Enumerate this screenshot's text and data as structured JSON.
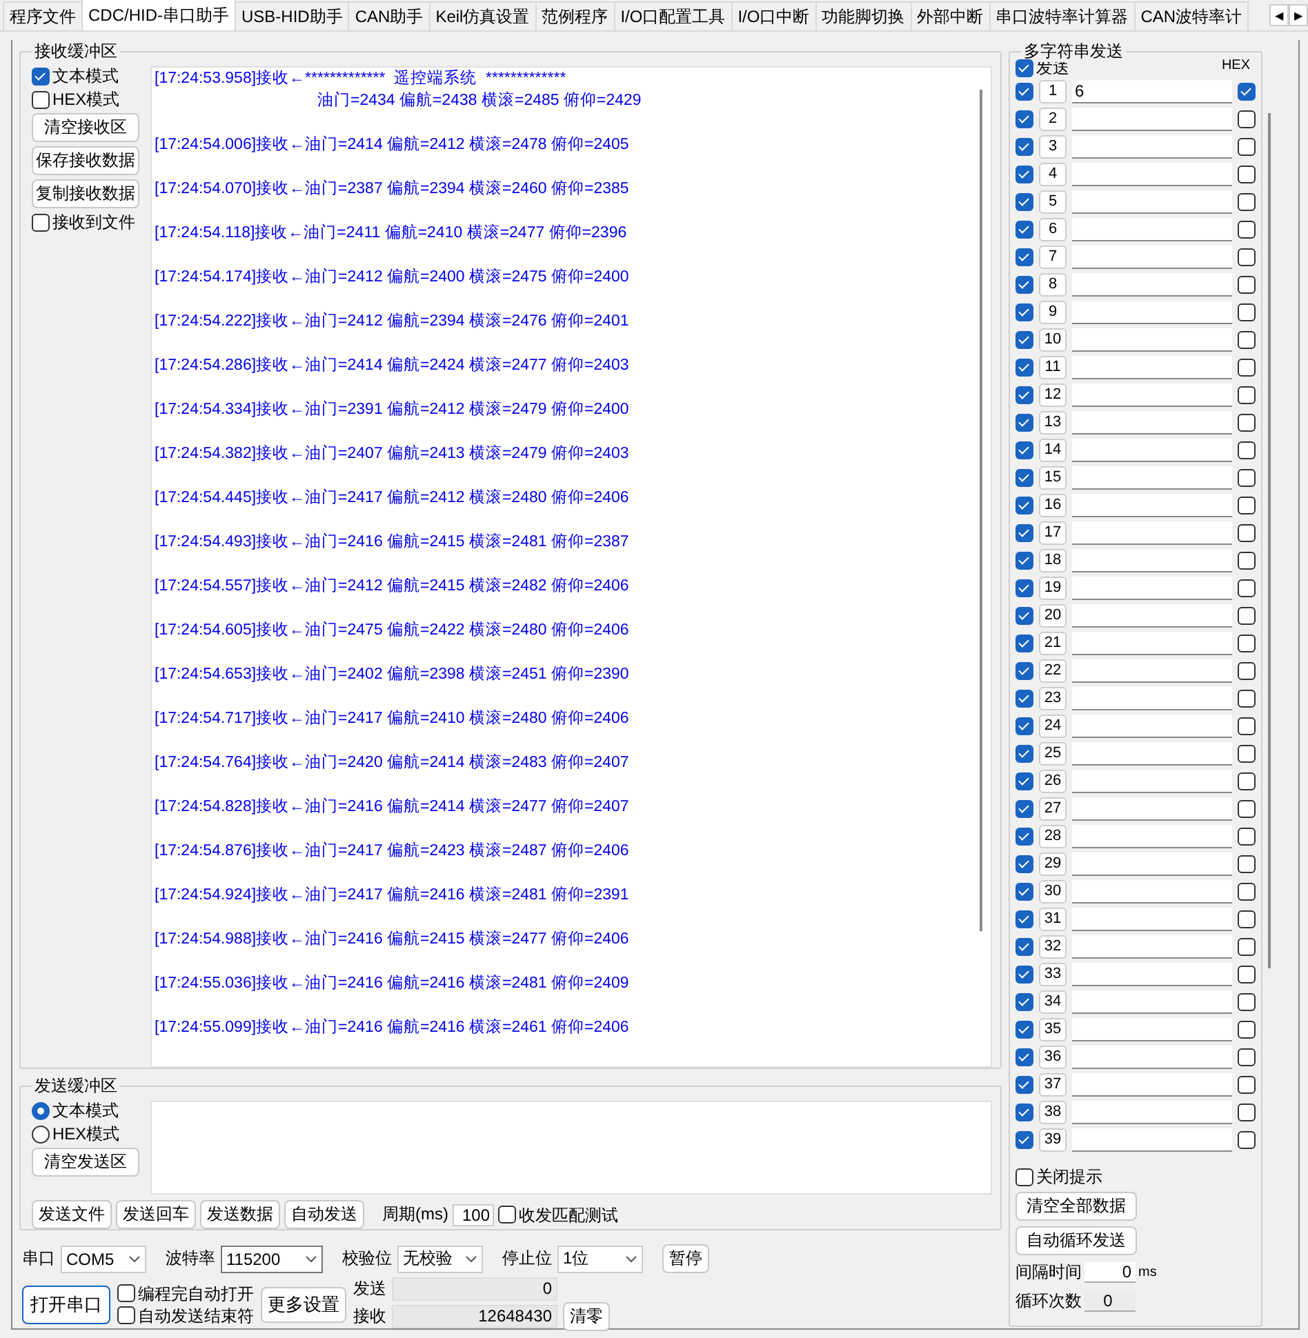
{
  "tabs": [
    {
      "label": "程序文件",
      "selected": false
    },
    {
      "label": "CDC/HID-串口助手",
      "selected": true
    },
    {
      "label": "USB-HID助手",
      "selected": false
    },
    {
      "label": "CAN助手",
      "selected": false
    },
    {
      "label": "Keil仿真设置",
      "selected": false
    },
    {
      "label": "范例程序",
      "selected": false
    },
    {
      "label": "I/O口配置工具",
      "selected": false
    },
    {
      "label": "I/O口中断",
      "selected": false
    },
    {
      "label": "功能脚切换",
      "selected": false
    },
    {
      "label": "外部中断",
      "selected": false
    },
    {
      "label": "串口波特率计算器",
      "selected": false
    },
    {
      "label": "CAN波特率计",
      "selected": false
    }
  ],
  "tab_scroll": [
    "◀",
    "▶"
  ],
  "receive": {
    "title": "接收缓冲区",
    "modes": [
      {
        "label": "文本模式",
        "checked": true
      },
      {
        "label": "HEX模式",
        "checked": false
      }
    ],
    "buttons": [
      "清空接收区",
      "保存接收数据",
      "复制接收数据"
    ],
    "to_file": {
      "label": "接收到文件",
      "checked": false
    },
    "log": [
      {
        "text": "[17:24:53.958]接收←*************  遥控端系统  *************",
        "continuation": "油门=2434 偏航=2438 横滚=2485 俯仰=2429"
      },
      {
        "text": "[17:24:54.006]接收←油门=2414 偏航=2412 横滚=2478 俯仰=2405"
      },
      {
        "text": "[17:24:54.070]接收←油门=2387 偏航=2394 横滚=2460 俯仰=2385"
      },
      {
        "text": "[17:24:54.118]接收←油门=2411 偏航=2410 横滚=2477 俯仰=2396"
      },
      {
        "text": "[17:24:54.174]接收←油门=2412 偏航=2400 横滚=2475 俯仰=2400"
      },
      {
        "text": "[17:24:54.222]接收←油门=2412 偏航=2394 横滚=2476 俯仰=2401"
      },
      {
        "text": "[17:24:54.286]接收←油门=2414 偏航=2424 横滚=2477 俯仰=2403"
      },
      {
        "text": "[17:24:54.334]接收←油门=2391 偏航=2412 横滚=2479 俯仰=2400"
      },
      {
        "text": "[17:24:54.382]接收←油门=2407 偏航=2413 横滚=2479 俯仰=2403"
      },
      {
        "text": "[17:24:54.445]接收←油门=2417 偏航=2412 横滚=2480 俯仰=2406"
      },
      {
        "text": "[17:24:54.493]接收←油门=2416 偏航=2415 横滚=2481 俯仰=2387"
      },
      {
        "text": "[17:24:54.557]接收←油门=2412 偏航=2415 横滚=2482 俯仰=2406"
      },
      {
        "text": "[17:24:54.605]接收←油门=2475 偏航=2422 横滚=2480 俯仰=2406"
      },
      {
        "text": "[17:24:54.653]接收←油门=2402 偏航=2398 横滚=2451 俯仰=2390"
      },
      {
        "text": "[17:24:54.717]接收←油门=2417 偏航=2410 横滚=2480 俯仰=2406"
      },
      {
        "text": "[17:24:54.764]接收←油门=2420 偏航=2414 横滚=2483 俯仰=2407"
      },
      {
        "text": "[17:24:54.828]接收←油门=2416 偏航=2414 横滚=2477 俯仰=2407"
      },
      {
        "text": "[17:24:54.876]接收←油门=2417 偏航=2423 横滚=2487 俯仰=2406"
      },
      {
        "text": "[17:24:54.924]接收←油门=2417 偏航=2416 横滚=2481 俯仰=2391"
      },
      {
        "text": "[17:24:54.988]接收←油门=2416 偏航=2415 横滚=2477 俯仰=2406"
      },
      {
        "text": "[17:24:55.036]接收←油门=2416 偏航=2416 横滚=2481 俯仰=2409"
      },
      {
        "text": "[17:24:55.099]接收←油门=2416 偏航=2416 横滚=2461 俯仰=2406"
      }
    ]
  },
  "send": {
    "title": "发送缓冲区",
    "modes": [
      {
        "label": "文本模式",
        "selected": true
      },
      {
        "label": "HEX模式",
        "selected": false
      }
    ],
    "clear_button": "清空发送区",
    "buttons": [
      "发送文件",
      "发送回车",
      "发送数据",
      "自动发送"
    ],
    "period_label": "周期(ms)",
    "period": "100",
    "match_test": {
      "label": "收发匹配测试",
      "checked": false
    }
  },
  "port": {
    "selects": [
      {
        "label": "串口",
        "value": "COM5"
      },
      {
        "label": "波特率",
        "value": "115200"
      },
      {
        "label": "校验位",
        "value": "无校验"
      },
      {
        "label": "停止位",
        "value": "1位"
      }
    ],
    "pause_button": "暂停",
    "open_button": "打开串口",
    "options": [
      {
        "label": "编程完自动打开",
        "checked": false
      },
      {
        "label": "自动发送结束符",
        "checked": false
      }
    ],
    "more_button": "更多设置",
    "counters": [
      {
        "label": "发送",
        "value": "0"
      },
      {
        "label": "接收",
        "value": "12648430"
      }
    ],
    "reset_button": "清零"
  },
  "multi": {
    "title": "多字符串发送",
    "send_all": {
      "label": "发送",
      "checked": true
    },
    "hex_header": "HEX",
    "rows": [
      {
        "number": "1",
        "checked": true,
        "value": "6",
        "hex": true
      },
      {
        "number": "2",
        "checked": true,
        "hex": false
      },
      {
        "number": "3",
        "checked": true,
        "hex": false
      },
      {
        "number": "4",
        "checked": true,
        "hex": false
      },
      {
        "number": "5",
        "checked": true,
        "hex": false
      },
      {
        "number": "6",
        "checked": true,
        "hex": false
      },
      {
        "number": "7",
        "checked": true,
        "hex": false
      },
      {
        "number": "8",
        "checked": true,
        "hex": false
      },
      {
        "number": "9",
        "checked": true,
        "hex": false
      },
      {
        "number": "10",
        "checked": true,
        "hex": false
      },
      {
        "number": "11",
        "checked": true,
        "hex": false
      },
      {
        "number": "12",
        "checked": true,
        "hex": false
      },
      {
        "number": "13",
        "checked": true,
        "hex": false
      },
      {
        "number": "14",
        "checked": true,
        "hex": false
      },
      {
        "number": "15",
        "checked": true,
        "hex": false
      },
      {
        "number": "16",
        "checked": true,
        "hex": false
      },
      {
        "number": "17",
        "checked": true,
        "hex": false
      },
      {
        "number": "18",
        "checked": true,
        "hex": false
      },
      {
        "number": "19",
        "checked": true,
        "hex": false
      },
      {
        "number": "20",
        "checked": true,
        "hex": false
      },
      {
        "number": "21",
        "checked": true,
        "hex": false
      },
      {
        "number": "22",
        "checked": true,
        "hex": false
      },
      {
        "number": "23",
        "checked": true,
        "hex": false
      },
      {
        "number": "24",
        "checked": true,
        "hex": false
      },
      {
        "number": "25",
        "checked": true,
        "hex": false
      },
      {
        "number": "26",
        "checked": true,
        "hex": false
      },
      {
        "number": "27",
        "checked": true,
        "hex": false
      },
      {
        "number": "28",
        "checked": true,
        "hex": false
      },
      {
        "number": "29",
        "checked": true,
        "hex": false
      },
      {
        "number": "30",
        "checked": true,
        "hex": false
      },
      {
        "number": "31",
        "checked": true,
        "hex": false
      },
      {
        "number": "32",
        "checked": true,
        "hex": false
      },
      {
        "number": "33",
        "checked": true,
        "hex": false
      },
      {
        "number": "34",
        "checked": true,
        "hex": false
      },
      {
        "number": "35",
        "checked": true,
        "hex": false
      },
      {
        "number": "36",
        "checked": true,
        "hex": false
      },
      {
        "number": "37",
        "checked": true,
        "hex": false
      },
      {
        "number": "38",
        "checked": true,
        "hex": false
      },
      {
        "number": "39",
        "checked": true,
        "hex": false
      }
    ],
    "close_tip": {
      "label": "关闭提示",
      "checked": false
    },
    "buttons": [
      "清空全部数据",
      "自动循环发送"
    ],
    "interval": {
      "label": "间隔时间",
      "value": "0",
      "unit": "ms"
    },
    "cycles": {
      "label": "循环次数",
      "value": "0"
    }
  }
}
